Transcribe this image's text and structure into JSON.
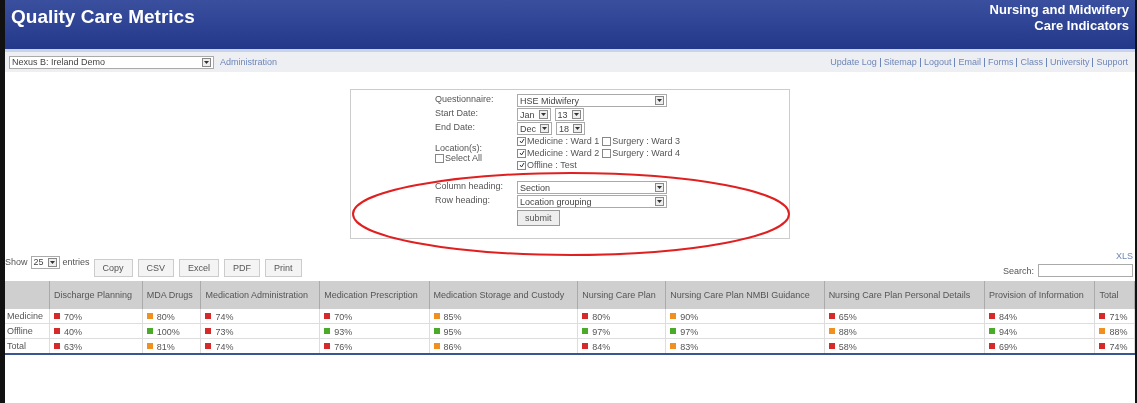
{
  "header": {
    "title": "Quality Care Metrics",
    "subtitle_lines": [
      "Nursing and Midwifery",
      "Care Indicators"
    ]
  },
  "toolbar": {
    "site_select": "Nexus B: Ireland Demo",
    "admin_link": "Administration",
    "links": [
      "Update Log",
      "Sitemap",
      "Logout",
      "Email",
      "Forms",
      "Class",
      "University",
      "Support"
    ]
  },
  "form": {
    "fields": [
      {
        "kind": "select",
        "label": "Questionnaire:",
        "values": [
          "HSE Midwifery"
        ]
      },
      {
        "kind": "date",
        "label": "Start Date:",
        "values": [
          "Jan",
          "13"
        ]
      },
      {
        "kind": "date",
        "label": "End Date:",
        "values": [
          "Dec",
          "18"
        ]
      }
    ],
    "locations_label": "Location(s):",
    "select_all": {
      "label": "Select All",
      "checked": false
    },
    "locations": [
      {
        "label": "Medicine : Ward 1",
        "checked": true
      },
      {
        "label": "Surgery : Ward 3",
        "checked": false
      },
      {
        "label": "Medicine : Ward 2",
        "checked": true
      },
      {
        "label": "Surgery : Ward 4",
        "checked": false
      },
      {
        "label": "Offline : Test",
        "checked": true
      }
    ],
    "headings": [
      {
        "label": "Column heading:",
        "value": "Section"
      },
      {
        "label": "Row heading:",
        "value": "Location grouping"
      }
    ],
    "submit": "submit"
  },
  "table_controls": {
    "show_label": "Show",
    "page_size": "25",
    "entries_label": "entries",
    "buttons": [
      "Copy",
      "CSV",
      "Excel",
      "PDF",
      "Print"
    ],
    "export_link": "XLS",
    "search_label": "Search:"
  },
  "table": {
    "columns": [
      "Discharge Planning",
      "MDA Drugs",
      "Medication Administration",
      "Medication Prescription",
      "Medication Storage and Custody",
      "Nursing Care Plan",
      "Nursing Care Plan NMBI Guidance",
      "Nursing Care Plan Personal Details",
      "Provision of Information",
      "Total"
    ],
    "rows": [
      {
        "label": "Medicine",
        "cells": [
          {
            "value": "70%",
            "color": "#d42a2a"
          },
          {
            "value": "80%",
            "color": "#f0901e"
          },
          {
            "value": "74%",
            "color": "#d42a2a"
          },
          {
            "value": "70%",
            "color": "#d42a2a"
          },
          {
            "value": "85%",
            "color": "#f0901e"
          },
          {
            "value": "80%",
            "color": "#d42a2a"
          },
          {
            "value": "90%",
            "color": "#f0901e"
          },
          {
            "value": "65%",
            "color": "#d42a2a"
          },
          {
            "value": "84%",
            "color": "#d42a2a"
          },
          {
            "value": "71%",
            "color": "#d42a2a"
          }
        ]
      },
      {
        "label": "Offline",
        "cells": [
          {
            "value": "40%",
            "color": "#d42a2a"
          },
          {
            "value": "100%",
            "color": "#4caa2a"
          },
          {
            "value": "73%",
            "color": "#d42a2a"
          },
          {
            "value": "93%",
            "color": "#4caa2a"
          },
          {
            "value": "95%",
            "color": "#4caa2a"
          },
          {
            "value": "97%",
            "color": "#4caa2a"
          },
          {
            "value": "97%",
            "color": "#4caa2a"
          },
          {
            "value": "88%",
            "color": "#f0901e"
          },
          {
            "value": "94%",
            "color": "#4caa2a"
          },
          {
            "value": "88%",
            "color": "#f0901e"
          }
        ]
      },
      {
        "label": "Total",
        "cells": [
          {
            "value": "63%",
            "color": "#d42a2a"
          },
          {
            "value": "81%",
            "color": "#f0901e"
          },
          {
            "value": "74%",
            "color": "#d42a2a"
          },
          {
            "value": "76%",
            "color": "#d42a2a"
          },
          {
            "value": "86%",
            "color": "#f0901e"
          },
          {
            "value": "84%",
            "color": "#d42a2a"
          },
          {
            "value": "83%",
            "color": "#f0901e"
          },
          {
            "value": "58%",
            "color": "#d42a2a"
          },
          {
            "value": "69%",
            "color": "#d42a2a"
          },
          {
            "value": "74%",
            "color": "#d42a2a"
          }
        ]
      }
    ]
  }
}
